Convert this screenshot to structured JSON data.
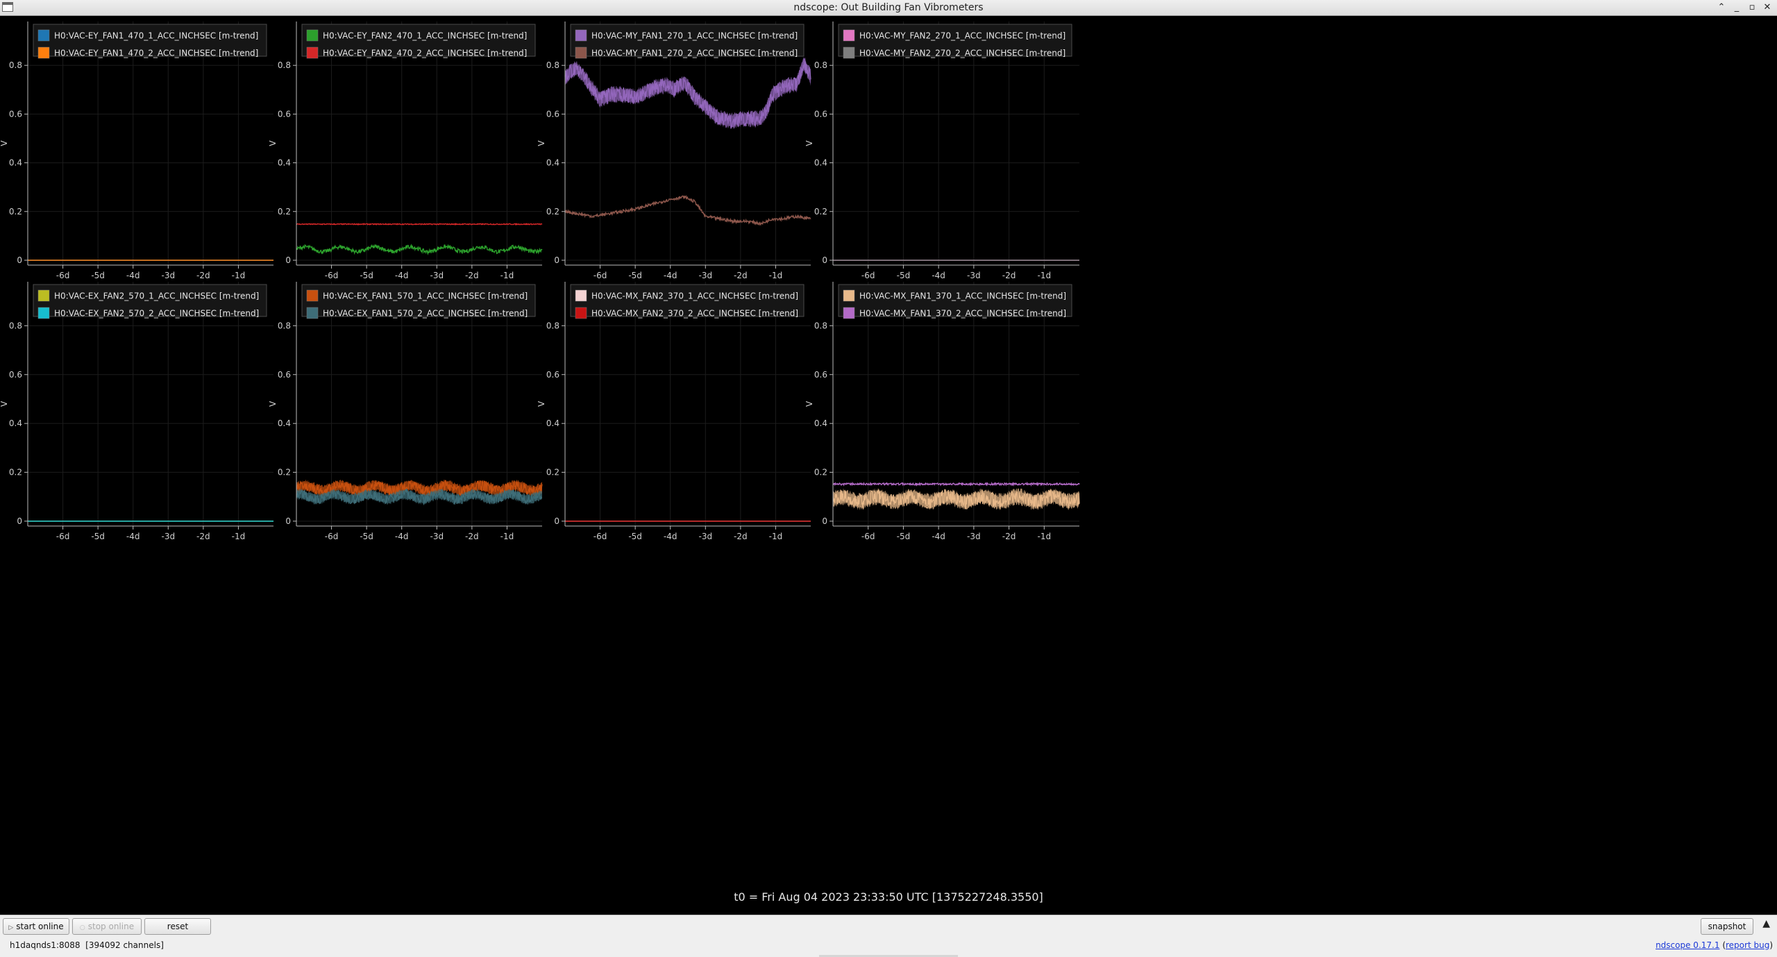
{
  "window": {
    "title": "ndscope: Out Building Fan Vibrometers",
    "controls": {
      "shade": "⌃",
      "minimize": "_",
      "maximize": "▫",
      "close": "✕"
    }
  },
  "colors": {
    "background": "#000000",
    "axis": "#bdbdbd",
    "grid": "#1c1c1c",
    "legend_bg": "#161616",
    "legend_border": "#4a4a4a"
  },
  "axes": {
    "ylabel": "V",
    "y_ticks": [
      "0",
      "0.2",
      "0.4",
      "0.6",
      "0.8"
    ],
    "x_ticks": [
      "-6d",
      "-5d",
      "-4d",
      "-3d",
      "-2d",
      "-1d"
    ]
  },
  "chart_data": [
    {
      "type": "line",
      "ylabel": "V",
      "ylim": [
        -0.02,
        0.98
      ],
      "xlim": [
        -7.0,
        0.0
      ],
      "grid": true,
      "legend": "top-left",
      "series": [
        {
          "name": "H0:VAC-EY_FAN1_470_1_ACC_INCHSEC [m-trend]",
          "color": "#1f77b4",
          "mean": 0.0,
          "amp": 0.0,
          "noise": 0.0
        },
        {
          "name": "H0:VAC-EY_FAN1_470_2_ACC_INCHSEC [m-trend]",
          "color": "#ff7f0e",
          "mean": 0.0,
          "amp": 0.0,
          "noise": 0.0
        }
      ]
    },
    {
      "type": "line",
      "ylabel": "V",
      "ylim": [
        -0.02,
        0.98
      ],
      "xlim": [
        -7.0,
        0.0
      ],
      "grid": true,
      "legend": "top-left",
      "series": [
        {
          "name": "H0:VAC-EY_FAN2_470_1_ACC_INCHSEC [m-trend]",
          "color": "#2ca02c",
          "mean": 0.045,
          "amp": 0.01,
          "noise": 0.008
        },
        {
          "name": "H0:VAC-EY_FAN2_470_2_ACC_INCHSEC [m-trend]",
          "color": "#d62728",
          "mean": 0.148,
          "amp": 0.0,
          "noise": 0.002
        }
      ]
    },
    {
      "type": "line",
      "ylabel": "V",
      "ylim": [
        -0.02,
        0.98
      ],
      "xlim": [
        -7.0,
        0.0
      ],
      "grid": true,
      "legend": "top-left",
      "series": [
        {
          "name": "H0:VAC-MY_FAN1_270_1_ACC_INCHSEC [m-trend]",
          "color": "#9467bd",
          "noise": 0.03,
          "x": [
            -7.0,
            -6.7,
            -6.5,
            -6.3,
            -6.0,
            -5.7,
            -5.3,
            -5.0,
            -4.7,
            -4.4,
            -4.1,
            -3.9,
            -3.6,
            -3.3,
            -3.0,
            -2.7,
            -2.3,
            -2.0,
            -1.7,
            -1.5,
            -1.3,
            -1.1,
            -0.9,
            -0.6,
            -0.4,
            -0.2,
            0.0
          ],
          "values": [
            0.75,
            0.79,
            0.76,
            0.72,
            0.66,
            0.68,
            0.68,
            0.67,
            0.69,
            0.71,
            0.72,
            0.7,
            0.73,
            0.67,
            0.63,
            0.59,
            0.57,
            0.58,
            0.58,
            0.58,
            0.6,
            0.68,
            0.7,
            0.72,
            0.72,
            0.81,
            0.75
          ]
        },
        {
          "name": "H0:VAC-MY_FAN1_270_2_ACC_INCHSEC [m-trend]",
          "color": "#8c564b",
          "noise": 0.006,
          "x": [
            -7.0,
            -6.6,
            -6.2,
            -5.8,
            -5.4,
            -5.0,
            -4.5,
            -4.0,
            -3.6,
            -3.3,
            -3.0,
            -2.6,
            -2.2,
            -1.8,
            -1.4,
            -1.1,
            -0.8,
            -0.4,
            0.0
          ],
          "values": [
            0.2,
            0.19,
            0.18,
            0.19,
            0.2,
            0.21,
            0.23,
            0.25,
            0.26,
            0.24,
            0.18,
            0.17,
            0.16,
            0.16,
            0.15,
            0.17,
            0.17,
            0.18,
            0.17
          ]
        }
      ]
    },
    {
      "type": "line",
      "ylabel": "V",
      "ylim": [
        -0.02,
        0.98
      ],
      "xlim": [
        -7.0,
        0.0
      ],
      "grid": true,
      "legend": "top-left",
      "series": [
        {
          "name": "H0:VAC-MY_FAN2_270_1_ACC_INCHSEC [m-trend]",
          "color": "#e377c2",
          "mean": 0.0,
          "amp": 0.0,
          "noise": 0.0
        },
        {
          "name": "H0:VAC-MY_FAN2_270_2_ACC_INCHSEC [m-trend]",
          "color": "#7f7f7f",
          "mean": 0.0,
          "amp": 0.0,
          "noise": 0.0
        }
      ]
    },
    {
      "type": "line",
      "ylabel": "V",
      "ylim": [
        -0.02,
        0.98
      ],
      "xlim": [
        -7.0,
        0.0
      ],
      "grid": true,
      "legend": "top-left",
      "series": [
        {
          "name": "H0:VAC-EX_FAN2_570_1_ACC_INCHSEC [m-trend]",
          "color": "#bcbd22",
          "mean": 0.0,
          "amp": 0.0,
          "noise": 0.0
        },
        {
          "name": "H0:VAC-EX_FAN2_570_2_ACC_INCHSEC [m-trend]",
          "color": "#17becf",
          "mean": 0.0,
          "amp": 0.0,
          "noise": 0.0
        }
      ]
    },
    {
      "type": "line",
      "ylabel": "V",
      "ylim": [
        -0.02,
        0.98
      ],
      "xlim": [
        -7.0,
        0.0
      ],
      "grid": true,
      "legend": "top-left",
      "series": [
        {
          "name": "H0:VAC-EX_FAN1_570_1_ACC_INCHSEC [m-trend]",
          "color": "#c8500f",
          "mean": 0.135,
          "amp": 0.01,
          "noise": 0.022
        },
        {
          "name": "H0:VAC-EX_FAN1_570_2_ACC_INCHSEC [m-trend]",
          "color": "#3e6d78",
          "mean": 0.1,
          "amp": 0.01,
          "noise": 0.02
        }
      ]
    },
    {
      "type": "line",
      "ylabel": "V",
      "ylim": [
        -0.02,
        0.98
      ],
      "xlim": [
        -7.0,
        0.0
      ],
      "grid": true,
      "legend": "top-left",
      "series": [
        {
          "name": "H0:VAC-MX_FAN2_370_1_ACC_INCHSEC [m-trend]",
          "color": "#f4d3d3",
          "mean": 0.0,
          "amp": 0.0,
          "noise": 0.0
        },
        {
          "name": "H0:VAC-MX_FAN2_370_2_ACC_INCHSEC [m-trend]",
          "color": "#c81414",
          "mean": 0.0,
          "amp": 0.0,
          "noise": 0.0
        }
      ]
    },
    {
      "type": "line",
      "ylabel": "V",
      "ylim": [
        -0.02,
        0.98
      ],
      "xlim": [
        -7.0,
        0.0
      ],
      "grid": true,
      "legend": "top-left",
      "series": [
        {
          "name": "H0:VAC-MX_FAN1_370_1_ACC_INCHSEC [m-trend]",
          "color": "#e8b98a",
          "mean": 0.09,
          "amp": 0.01,
          "noise": 0.03
        },
        {
          "name": "H0:VAC-MX_FAN1_370_2_ACC_INCHSEC [m-trend]",
          "color": "#b36ac7",
          "mean": 0.152,
          "amp": 0.0,
          "noise": 0.004
        }
      ]
    }
  ],
  "t0_text": "t0 = Fri Aug 04 2023 23:33:50 UTC [1375227248.3550]",
  "controls": {
    "start_online": "start online",
    "stop_online": "stop online",
    "reset": "reset",
    "snapshot": "snapshot",
    "collapse": "▲"
  },
  "footer": {
    "server": "h1daqnds1:8088  [394092 channels]",
    "version": "ndscope 0.17.1",
    "report_open": "(",
    "report_bug": "report bug",
    "report_close": ")"
  }
}
